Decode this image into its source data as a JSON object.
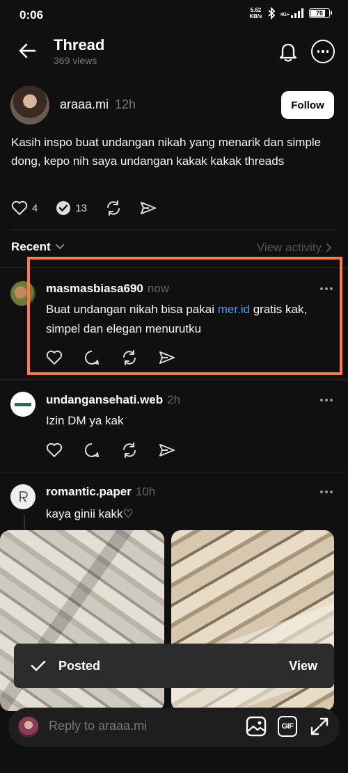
{
  "status_bar": {
    "time": "0:06",
    "net_speed_value": "5.62",
    "net_speed_unit": "KB/s",
    "network_type": "4G+",
    "battery": "76",
    "battery_level": 0.76
  },
  "header": {
    "title": "Thread",
    "views": "369 views"
  },
  "post": {
    "username": "araaa.mi",
    "time": "12h",
    "follow_label": "Follow",
    "text": "Kasih inspo buat undangan nikah yang menarik dan simple dong, kepo nih saya undangan kakak kakak threads",
    "likes": "4",
    "replies": "13"
  },
  "sort": {
    "label": "Recent",
    "view_activity": "View activity"
  },
  "replies": [
    {
      "username": "masmasbiasa690",
      "time": "now",
      "text_before": "Buat undangan nikah bisa pakai ",
      "link": "mer.id",
      "text_after": " gratis kak, simpel dan elegan menurutku"
    },
    {
      "username": "undangansehati.web",
      "time": "2h",
      "text": "Izin DM ya kak"
    },
    {
      "username": "romantic.paper",
      "time": "10h",
      "text": "kaya ginii kakk♡"
    }
  ],
  "toast": {
    "label": "Posted",
    "action": "View"
  },
  "composer": {
    "placeholder": "Reply to araaa.mi",
    "gif_label": "GIF"
  },
  "colors": {
    "background": "#101010",
    "link": "#4a9ff5",
    "highlight": "#ff7a45",
    "verified": "#ffffff"
  },
  "icons": [
    "back-arrow-icon",
    "bell-icon",
    "more-icon",
    "heart-icon",
    "comment-icon",
    "repost-icon",
    "share-icon",
    "chevron-down-icon",
    "chevron-right-icon",
    "check-icon",
    "image-icon",
    "gif-icon",
    "expand-icon"
  ]
}
